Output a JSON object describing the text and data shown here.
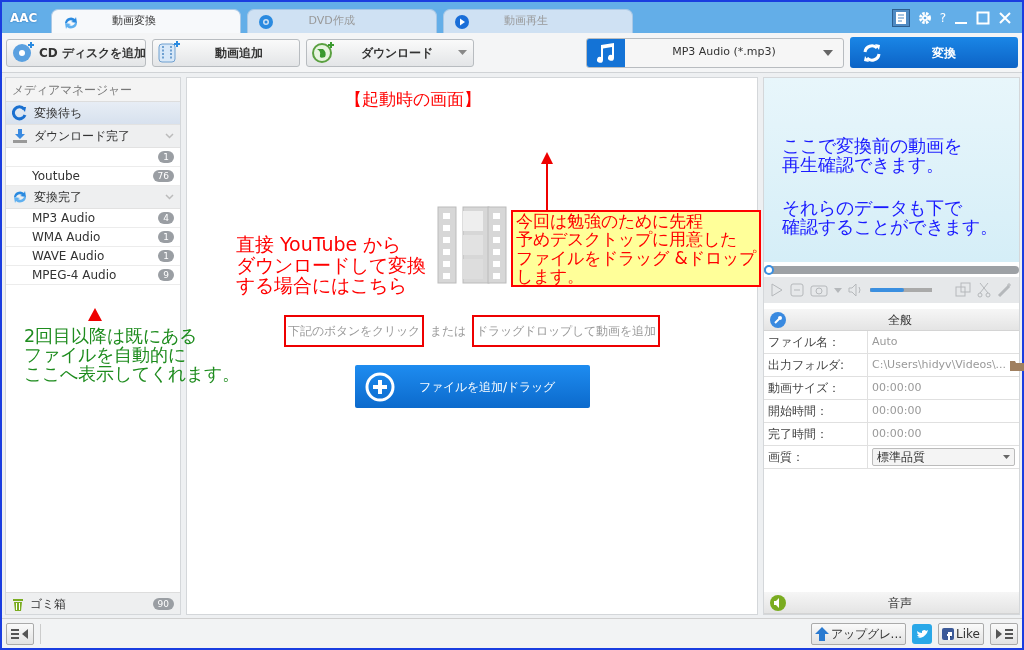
{
  "window": {
    "logo": "AAC",
    "help": "?",
    "tabs": [
      {
        "label": "動画変換",
        "selected": true,
        "kind": "convert"
      },
      {
        "label": "DVD作成",
        "selected": false,
        "kind": "dvd"
      },
      {
        "label": "動画再生",
        "selected": false,
        "kind": "play"
      }
    ]
  },
  "toolbar": {
    "buttons": [
      {
        "label": "CD ディスクを追加",
        "kind": "cd"
      },
      {
        "label": "動画追加",
        "kind": "film"
      },
      {
        "label": "ダウンロード",
        "kind": "globe",
        "dropdown": true
      }
    ],
    "format": "MP3 Audio (*.mp3)",
    "convert": "変換"
  },
  "media_manager": {
    "title": "メディアマネージャー",
    "groups": [
      {
        "label": "変換待ち",
        "kind": "queue",
        "selected": true,
        "collapsible": false
      },
      {
        "label": "ダウンロード完了",
        "kind": "download",
        "selected": false,
        "collapsible": true,
        "items": [
          {
            "count": "1"
          },
          {
            "name": "Youtube",
            "count": "76"
          }
        ]
      },
      {
        "label": "変換完了",
        "kind": "done",
        "selected": false,
        "collapsible": true,
        "items": [
          {
            "name": "MP3 Audio",
            "count": "4"
          },
          {
            "name": "WMA Audio",
            "count": "1"
          },
          {
            "name": "WAVE Audio",
            "count": "1"
          },
          {
            "name": "MPEG-4 Audio",
            "count": "9"
          }
        ]
      }
    ],
    "trash": {
      "label": "ゴミ箱",
      "count": "90"
    }
  },
  "drop_area": {
    "hint": [
      {
        "text": "下記のボタンをクリック",
        "highlighted": true
      },
      {
        "text": "または",
        "highlighted": false
      },
      {
        "text": "ドラッグドロップして動画を追加",
        "highlighted": true
      }
    ],
    "add_button": "ファイルを追加/ドラッグ"
  },
  "player": {
    "seek": {
      "level": 0
    },
    "volume": {
      "level": 0.55
    }
  },
  "properties": {
    "title": "全般",
    "rows": [
      {
        "label": "ファイル名：",
        "value": "Auto",
        "kind": "text"
      },
      {
        "label": "出力フォルダ:",
        "value": "C:\\Users\\hidyv\\Videos\\...",
        "kind": "folder"
      },
      {
        "label": "動画サイズ：",
        "value": "00:00:00",
        "kind": "text"
      },
      {
        "label": "開始時間：",
        "value": "00:00:00",
        "kind": "text"
      },
      {
        "label": "完了時間：",
        "value": "00:00:00",
        "kind": "text"
      },
      {
        "label": "画質：",
        "value": "標準品質",
        "kind": "select"
      }
    ],
    "audio": "音声"
  },
  "status_bar": {
    "upgrade": "アップグレ...",
    "like": "Like"
  },
  "annotations": {
    "title": "【起動時の画面】",
    "notes": [
      {
        "kind": "text",
        "color": "#ff0000",
        "lines": [
          "直接 YouTube から",
          "ダウンロードして変換",
          "する場合にはこちら"
        ]
      },
      {
        "kind": "callout",
        "color": "#ff0000",
        "lines": [
          "今回は勉強のために先程",
          "予めデスクトップに用意した",
          "ファイルをドラッグ &ドロップ",
          "します。"
        ]
      },
      {
        "kind": "text",
        "color": "#1e8c1e",
        "lines": [
          "2回目以降は既にある",
          "ファイルを自動的に",
          "ここへ表示してくれます。"
        ]
      },
      {
        "kind": "text",
        "color": "#1a1aff",
        "lines": [
          "ここで変換前の動画を",
          "再生確認できます。"
        ]
      },
      {
        "kind": "text",
        "color": "#1a1aff",
        "lines": [
          "それらのデータも下で",
          "確認することができます。"
        ]
      }
    ]
  }
}
